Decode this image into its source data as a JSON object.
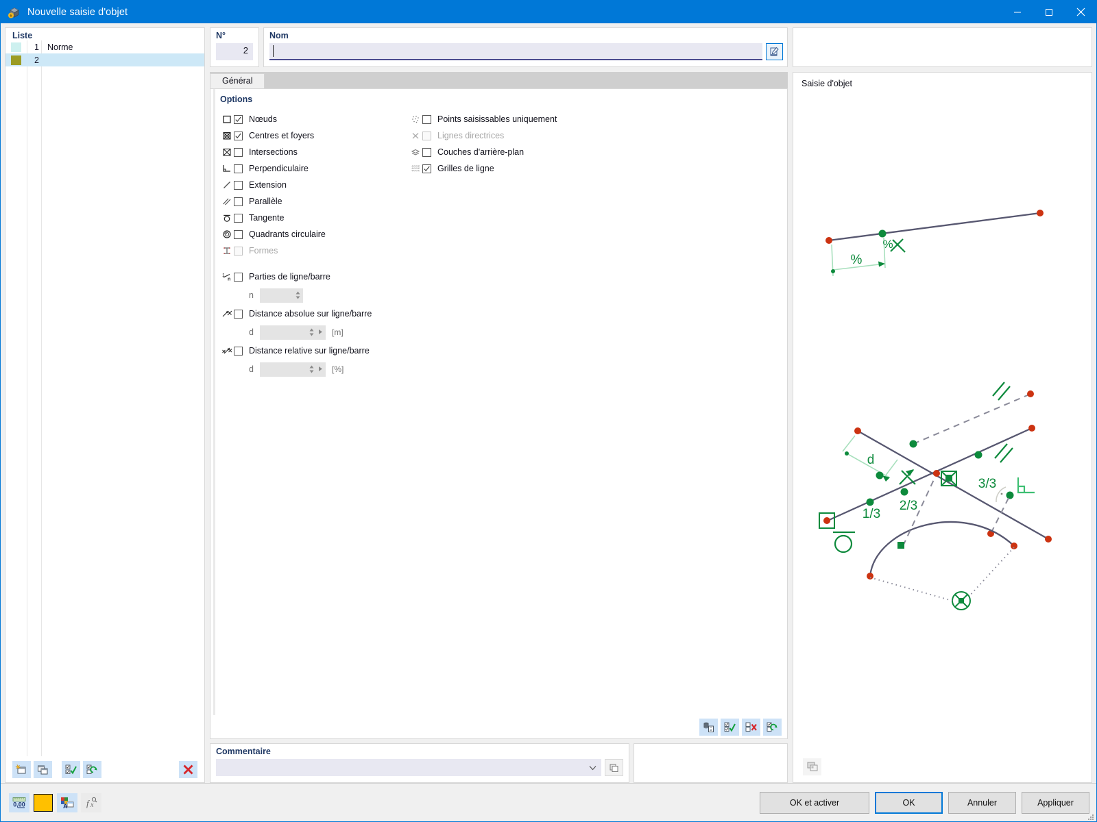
{
  "window": {
    "title": "Nouvelle saisie d'objet",
    "app_icon": "rfem-cube-icon",
    "minimize_label": "Réduire",
    "maximize_label": "Agrandir",
    "close_label": "Fermer"
  },
  "list_panel": {
    "header": "Liste",
    "rows": [
      {
        "color": "#cdf0ef",
        "number": "1",
        "name": "Norme",
        "selected": false
      },
      {
        "color": "#9c9c24",
        "number": "2",
        "name": "",
        "selected": true
      }
    ],
    "toolbar": [
      {
        "name": "new-entry-button",
        "icon": "new-window-icon"
      },
      {
        "name": "copy-entry-button",
        "icon": "copy-windows-icon"
      },
      {
        "name": "select-all-button",
        "icon": "checklist-check-icon"
      },
      {
        "name": "invert-selection-button",
        "icon": "checklist-refresh-icon"
      },
      {
        "name": "delete-entry-button",
        "icon": "red-x-icon"
      }
    ]
  },
  "fields": {
    "no_label": "N°",
    "no_value": "2",
    "nom_label": "Nom",
    "nom_value": "",
    "nom_placeholder": "",
    "nom_button_icon": "edit-pencil-icon"
  },
  "tabs": [
    {
      "label": "Général",
      "active": true
    }
  ],
  "options": {
    "title": "Options",
    "left_column": [
      {
        "icon": "node-square-icon",
        "label": "Nœuds",
        "checked": true,
        "enabled": true
      },
      {
        "icon": "center-focus-icon",
        "label": "Centres et foyers",
        "checked": true,
        "enabled": true
      },
      {
        "icon": "intersection-icon",
        "label": "Intersections",
        "checked": false,
        "enabled": true
      },
      {
        "icon": "perpendicular-icon",
        "label": "Perpendiculaire",
        "checked": false,
        "enabled": true
      },
      {
        "icon": "extension-line-icon",
        "label": "Extension",
        "checked": false,
        "enabled": true
      },
      {
        "icon": "parallel-lines-icon",
        "label": "Parallèle",
        "checked": false,
        "enabled": true
      },
      {
        "icon": "tangent-circle-icon",
        "label": "Tangente",
        "checked": false,
        "enabled": true
      },
      {
        "icon": "circle-quadrant-icon",
        "label": "Quadrants circulaire",
        "checked": false,
        "enabled": true
      },
      {
        "icon": "shapes-i-beam-icon",
        "label": "Formes",
        "checked": false,
        "enabled": false
      }
    ],
    "right_column": [
      {
        "icon": "snap-points-icon",
        "label": "Points saisissables uniquement",
        "checked": false,
        "enabled": true
      },
      {
        "icon": "guide-lines-x-icon",
        "label": "Lignes directrices",
        "checked": false,
        "enabled": false
      },
      {
        "icon": "background-layers-icon",
        "label": "Couches d'arrière-plan",
        "checked": false,
        "enabled": true
      },
      {
        "icon": "line-grid-icon",
        "label": "Grilles de ligne",
        "checked": true,
        "enabled": true
      }
    ],
    "divisions": [
      {
        "icon": "fraction-1n-icon",
        "label": "Parties de ligne/barre",
        "checked": false,
        "sub_label": "n",
        "value": "",
        "unit": "",
        "has_play": false
      },
      {
        "icon": "absolute-distance-icon",
        "label": "Distance absolue sur ligne/barre",
        "checked": false,
        "sub_label": "d",
        "value": "",
        "unit": "[m]",
        "has_play": true
      },
      {
        "icon": "relative-distance-icon",
        "label": "Distance relative sur ligne/barre",
        "checked": false,
        "sub_label": "d",
        "value": "",
        "unit": "[%]",
        "has_play": true
      }
    ],
    "toolbar": [
      {
        "name": "import-from-library-button",
        "icon": "database-import-icon"
      },
      {
        "name": "select-all-options-button",
        "icon": "checkbox-check-icon"
      },
      {
        "name": "deselect-all-options-button",
        "icon": "checkbox-x-icon"
      },
      {
        "name": "invert-options-button",
        "icon": "checkbox-swap-icon"
      }
    ]
  },
  "comment": {
    "label": "Commentaire",
    "value": "",
    "placeholder": "",
    "dropdown_icon": "chevron-down-icon",
    "button_icon": "comment-copy-icon"
  },
  "preview": {
    "title": "Saisie d'objet",
    "toolbar_icon": "preview-render-icon",
    "labels": {
      "percent_dimension": "%",
      "percent_snap": "%",
      "distance": "d",
      "third_1": "1/3",
      "third_2": "2/3",
      "third_3": "3/3"
    },
    "colors": {
      "line": "#575770",
      "node_red": "#cc3311",
      "snap_green": "#009944",
      "dimension_green": "#a8e0bd"
    }
  },
  "footer": {
    "tools": [
      {
        "name": "decimal-places-button",
        "icon": "decimals-000-icon"
      },
      {
        "name": "color-swatch-button",
        "icon": "color-chip",
        "color": "#ffc000"
      },
      {
        "name": "display-properties-button",
        "icon": "display-props-icon"
      },
      {
        "name": "formula-button",
        "icon": "fx-formula-icon"
      }
    ],
    "buttons": [
      {
        "name": "ok-and-activate-button",
        "label": "OK et activer",
        "default": false,
        "wide": true
      },
      {
        "name": "ok-button",
        "label": "OK",
        "default": true,
        "wide": false
      },
      {
        "name": "cancel-button",
        "label": "Annuler",
        "default": false,
        "wide": false
      },
      {
        "name": "apply-button",
        "label": "Appliquer",
        "default": false,
        "wide": false
      }
    ]
  }
}
